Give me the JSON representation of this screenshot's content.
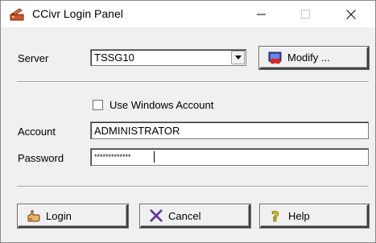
{
  "window": {
    "title": "CCivr Login Panel",
    "controls": {
      "minimize": "—",
      "maximize": "☐",
      "close": "✕"
    }
  },
  "server": {
    "label": "Server",
    "selected": "TSSG10",
    "modify_label": "Modify ..."
  },
  "windows_account": {
    "label": "Use Windows Account",
    "checked": false
  },
  "account": {
    "label": "Account",
    "value": "ADMINISTRATOR"
  },
  "password": {
    "label": "Password",
    "value": "*************"
  },
  "buttons": {
    "login": "Login",
    "cancel": "Cancel",
    "help": "Help"
  },
  "icons": {
    "app": "login-panel-icon",
    "modify": "modify-icon",
    "login": "key-hand-icon",
    "cancel": "cancel-x-icon",
    "help": "help-question-icon"
  }
}
